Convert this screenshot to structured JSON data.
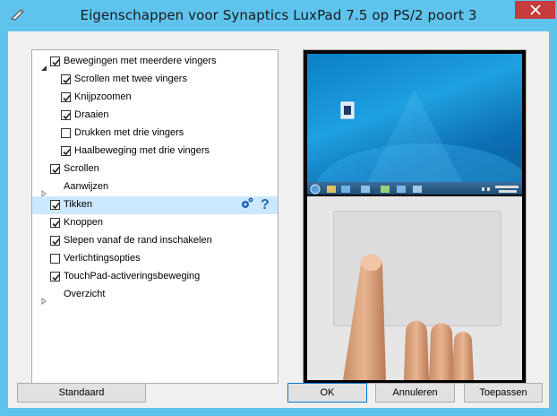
{
  "window": {
    "title": "Eigenschappen voor Synaptics LuxPad 7.5 op PS/2 poort 3",
    "title_bar_color": "#5ec4ee"
  },
  "tree": {
    "items": [
      {
        "label": "Bewegingen met meerdere vingers",
        "checked": true,
        "expander": "expanded",
        "level": 0
      },
      {
        "label": "Scrollen met twee vingers",
        "checked": true,
        "expander": "none",
        "level": 1
      },
      {
        "label": "Knijpzoomen",
        "checked": true,
        "expander": "none",
        "level": 1
      },
      {
        "label": "Draaien",
        "checked": true,
        "expander": "none",
        "level": 1
      },
      {
        "label": "Drukken met drie vingers",
        "checked": false,
        "expander": "none",
        "level": 1
      },
      {
        "label": "Haalbeweging met drie vingers",
        "checked": true,
        "expander": "none",
        "level": 1
      },
      {
        "label": "Scrollen",
        "checked": true,
        "expander": "none",
        "level": 0
      },
      {
        "label": "Aanwijzen",
        "checked": null,
        "expander": "collapsed",
        "level": 0
      },
      {
        "label": "Tikken",
        "checked": true,
        "expander": "none",
        "level": 0,
        "selected": true,
        "icons": [
          "settings-icon",
          "help-icon"
        ]
      },
      {
        "label": "Knoppen",
        "checked": true,
        "expander": "none",
        "level": 0
      },
      {
        "label": "Slepen vanaf de rand inschakelen",
        "checked": true,
        "expander": "none",
        "level": 0
      },
      {
        "label": "Verlichtingsopties",
        "checked": false,
        "expander": "none",
        "level": 0
      },
      {
        "label": "TouchPad-activeringsbeweging",
        "checked": true,
        "expander": "none",
        "level": 0
      },
      {
        "label": "Overzicht",
        "checked": null,
        "expander": "collapsed",
        "level": 0
      }
    ],
    "selection_color": "#cce8ff"
  },
  "buttons": {
    "default_label": "Standaard",
    "ok_label": "OK",
    "cancel_label": "Annuleren",
    "apply_label": "Toepassen"
  }
}
